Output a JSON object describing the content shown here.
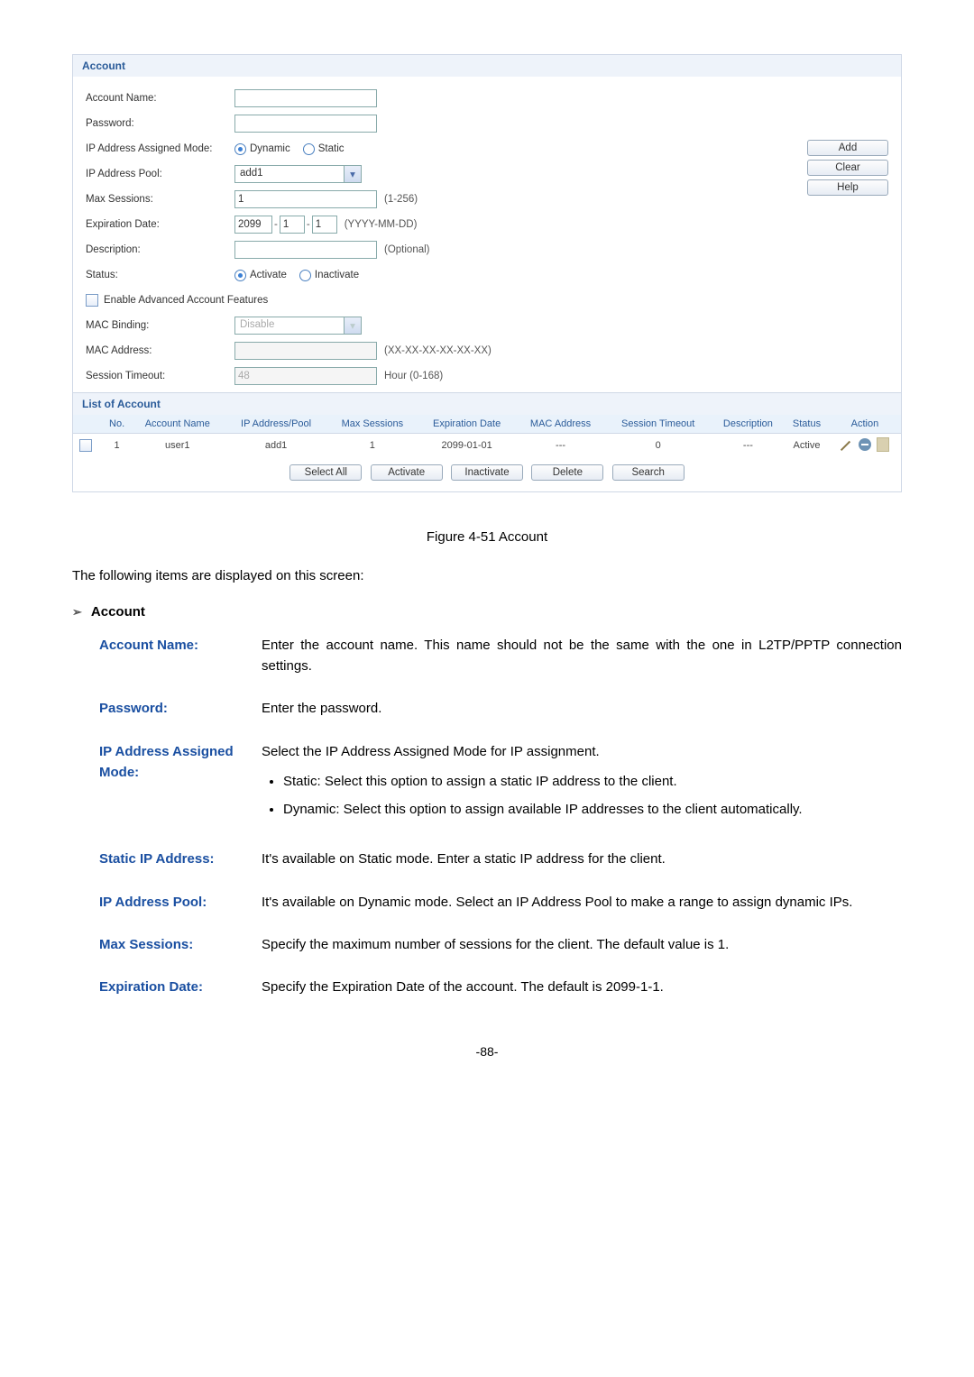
{
  "panel": {
    "title": "Account",
    "labels": {
      "accountName": "Account Name:",
      "password": "Password:",
      "ipMode": "IP Address Assigned Mode:",
      "ipPool": "IP Address Pool:",
      "maxSessions": "Max Sessions:",
      "expiration": "Expiration Date:",
      "description": "Description:",
      "status": "Status:",
      "enableAdv": "Enable Advanced Account Features",
      "macBinding": "MAC Binding:",
      "macAddress": "MAC Address:",
      "sessionTimeout": "Session Timeout:"
    },
    "values": {
      "ipPool": "add1",
      "maxSessions": "1",
      "expYear": "2099",
      "expMonth": "1",
      "expDay": "1",
      "macBinding": "Disable",
      "sessionTimeout": "48"
    },
    "hints": {
      "maxSessions": "(1-256)",
      "expiration": "(YYYY-MM-DD)",
      "description": "(Optional)",
      "macAddress": "(XX-XX-XX-XX-XX-XX)",
      "sessionTimeout": "Hour (0-168)"
    },
    "radios": {
      "dynamic": "Dynamic",
      "static": "Static",
      "activate": "Activate",
      "inactivate": "Inactivate"
    },
    "buttons": {
      "add": "Add",
      "clear": "Clear",
      "help": "Help"
    }
  },
  "list": {
    "title": "List of Account",
    "headers": {
      "no": "No.",
      "accountName": "Account Name",
      "ipPool": "IP Address/Pool",
      "maxSess": "Max Sessions",
      "expDate": "Expiration Date",
      "mac": "MAC Address",
      "sessTimeout": "Session Timeout",
      "desc": "Description",
      "status": "Status",
      "action": "Action"
    },
    "row": {
      "no": "1",
      "accountName": "user1",
      "ipPool": "add1",
      "maxSess": "1",
      "expDate": "2099-01-01",
      "mac": "---",
      "sessTimeout": "0",
      "desc": "---",
      "status": "Active"
    },
    "bottomButtons": {
      "selectAll": "Select All",
      "activate": "Activate",
      "inactivate": "Inactivate",
      "delete": "Delete",
      "search": "Search"
    }
  },
  "doc": {
    "figCaption": "Figure 4-51 Account",
    "intro": "The following items are displayed on this screen:",
    "sectionTitle": "Account",
    "defs": {
      "accountName": {
        "term": "Account Name:",
        "desc": "Enter the account name. This name should not be the same with the one in L2TP/PPTP connection settings."
      },
      "password": {
        "term": "Password:",
        "desc": "Enter the password."
      },
      "ipMode": {
        "term": "IP Address Assigned Mode:",
        "desc": "Select the IP Address Assigned Mode for IP assignment.",
        "b1": "Static: Select this option to assign a static IP address to the client.",
        "b2": "Dynamic: Select this option to assign available IP addresses to the client automatically."
      },
      "staticIp": {
        "term": "Static IP Address:",
        "desc": "It's available on Static mode. Enter a static IP address for the client."
      },
      "ipPool": {
        "term": "IP Address Pool:",
        "desc": "It's available on Dynamic mode. Select an IP Address Pool to make a range to assign dynamic IPs."
      },
      "maxSessions": {
        "term": "Max Sessions:",
        "desc": "Specify the maximum number of sessions for the client. The default value is 1."
      },
      "expiration": {
        "term": "Expiration Date:",
        "desc": "Specify the Expiration Date of the account. The default is 2099-1-1."
      }
    },
    "pageNum": "-88-"
  }
}
